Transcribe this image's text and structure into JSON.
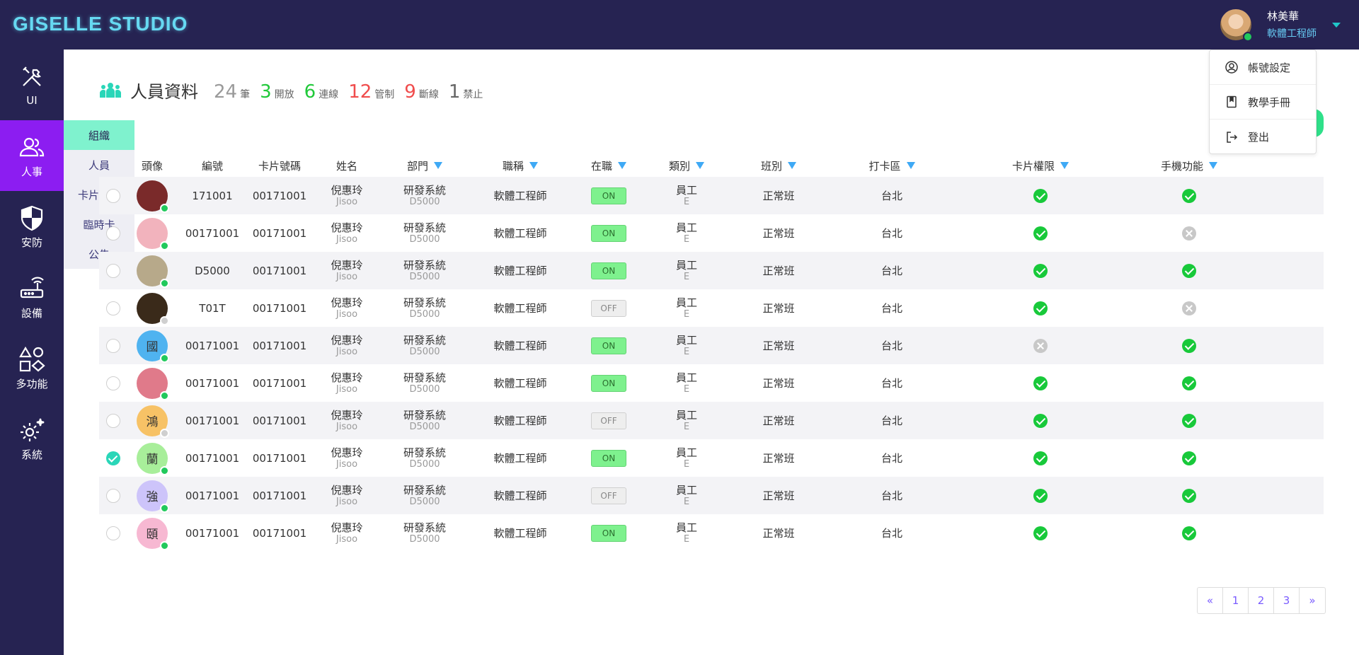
{
  "app": {
    "logo": "GISELLE STUDIO"
  },
  "user": {
    "name": "林美華",
    "role": "軟體工程師"
  },
  "user_menu": [
    {
      "label": "帳號設定",
      "icon": "account-circle-icon"
    },
    {
      "label": "教學手冊",
      "icon": "book-icon"
    },
    {
      "label": "登出",
      "icon": "logout-icon"
    }
  ],
  "sidebar": [
    {
      "label": "UI",
      "icon": "tools-icon",
      "active": false
    },
    {
      "label": "人事",
      "icon": "people-icon",
      "active": true
    },
    {
      "label": "安防",
      "icon": "shield-icon",
      "active": false
    },
    {
      "label": "設備",
      "icon": "router-icon",
      "active": false
    },
    {
      "label": "多功能",
      "icon": "shapes-icon",
      "active": false
    },
    {
      "label": "系統",
      "icon": "gear-icon",
      "active": false
    }
  ],
  "submenu": [
    "組織",
    "人員",
    "卡片權限",
    "臨時卡",
    "公告"
  ],
  "header": {
    "title": "人員資料",
    "stats": [
      {
        "num": "24",
        "label": "筆",
        "color": "gray"
      },
      {
        "num": "3",
        "label": "開放",
        "color": "green"
      },
      {
        "num": "6",
        "label": "連線",
        "color": "green"
      },
      {
        "num": "12",
        "label": "管制",
        "color": "red"
      },
      {
        "num": "9",
        "label": "斷線",
        "color": "red"
      },
      {
        "num": "1",
        "label": "禁止",
        "color": "dark"
      }
    ]
  },
  "table": {
    "columns": [
      "頭像",
      "編號",
      "卡片號碼",
      "姓名",
      "部門",
      "職稱",
      "在職",
      "類別",
      "班別",
      "打卡區",
      "卡片權限",
      "手機功能"
    ],
    "rows": [
      {
        "avatar": "",
        "avatar_bg": "#7a2a2a",
        "online": true,
        "id": "171001",
        "card": "00171001",
        "name": "倪惠玲",
        "name_en": "Jisoo",
        "dept": "研發系統",
        "dept_code": "D5000",
        "title": "軟體工程師",
        "active": "ON",
        "cat": "員工",
        "cat_code": "E",
        "shift": "正常班",
        "area": "台北",
        "perm": true,
        "phone": true,
        "selected": false
      },
      {
        "avatar": "",
        "avatar_bg": "#f2b3bd",
        "online": true,
        "id": "00171001",
        "card": "00171001",
        "name": "倪惠玲",
        "name_en": "Jisoo",
        "dept": "研發系統",
        "dept_code": "D5000",
        "title": "軟體工程師",
        "active": "ON",
        "cat": "員工",
        "cat_code": "E",
        "shift": "正常班",
        "area": "台北",
        "perm": true,
        "phone": false,
        "selected": false
      },
      {
        "avatar": "",
        "avatar_bg": "#b7a98a",
        "online": true,
        "id": "D5000",
        "card": "00171001",
        "name": "倪惠玲",
        "name_en": "Jisoo",
        "dept": "研發系統",
        "dept_code": "D5000",
        "title": "軟體工程師",
        "active": "ON",
        "cat": "員工",
        "cat_code": "E",
        "shift": "正常班",
        "area": "台北",
        "perm": true,
        "phone": true,
        "selected": false
      },
      {
        "avatar": "",
        "avatar_bg": "#3a2a1a",
        "online": false,
        "id": "T01T",
        "card": "00171001",
        "name": "倪惠玲",
        "name_en": "Jisoo",
        "dept": "研發系統",
        "dept_code": "D5000",
        "title": "軟體工程師",
        "active": "OFF",
        "cat": "員工",
        "cat_code": "E",
        "shift": "正常班",
        "area": "台北",
        "perm": true,
        "phone": false,
        "selected": false
      },
      {
        "avatar": "國",
        "avatar_bg": "#4fb3f0",
        "online": true,
        "id": "00171001",
        "card": "00171001",
        "name": "倪惠玲",
        "name_en": "Jisoo",
        "dept": "研發系統",
        "dept_code": "D5000",
        "title": "軟體工程師",
        "active": "ON",
        "cat": "員工",
        "cat_code": "E",
        "shift": "正常班",
        "area": "台北",
        "perm": false,
        "phone": true,
        "selected": false
      },
      {
        "avatar": "",
        "avatar_bg": "#e07a8a",
        "online": true,
        "id": "00171001",
        "card": "00171001",
        "name": "倪惠玲",
        "name_en": "Jisoo",
        "dept": "研發系統",
        "dept_code": "D5000",
        "title": "軟體工程師",
        "active": "ON",
        "cat": "員工",
        "cat_code": "E",
        "shift": "正常班",
        "area": "台北",
        "perm": true,
        "phone": true,
        "selected": false
      },
      {
        "avatar": "鴻",
        "avatar_bg": "#f7c266",
        "online": false,
        "id": "00171001",
        "card": "00171001",
        "name": "倪惠玲",
        "name_en": "Jisoo",
        "dept": "研發系統",
        "dept_code": "D5000",
        "title": "軟體工程師",
        "active": "OFF",
        "cat": "員工",
        "cat_code": "E",
        "shift": "正常班",
        "area": "台北",
        "perm": true,
        "phone": true,
        "selected": false
      },
      {
        "avatar": "蘭",
        "avatar_bg": "#a8ee9a",
        "online": true,
        "id": "00171001",
        "card": "00171001",
        "name": "倪惠玲",
        "name_en": "Jisoo",
        "dept": "研發系統",
        "dept_code": "D5000",
        "title": "軟體工程師",
        "active": "ON",
        "cat": "員工",
        "cat_code": "E",
        "shift": "正常班",
        "area": "台北",
        "perm": true,
        "phone": true,
        "selected": true
      },
      {
        "avatar": "強",
        "avatar_bg": "#cdc4fa",
        "online": true,
        "id": "00171001",
        "card": "00171001",
        "name": "倪惠玲",
        "name_en": "Jisoo",
        "dept": "研發系統",
        "dept_code": "D5000",
        "title": "軟體工程師",
        "active": "OFF",
        "cat": "員工",
        "cat_code": "E",
        "shift": "正常班",
        "area": "台北",
        "perm": true,
        "phone": true,
        "selected": false
      },
      {
        "avatar": "頤",
        "avatar_bg": "#f7b8d2",
        "online": true,
        "id": "00171001",
        "card": "00171001",
        "name": "倪惠玲",
        "name_en": "Jisoo",
        "dept": "研發系統",
        "dept_code": "D5000",
        "title": "軟體工程師",
        "active": "ON",
        "cat": "員工",
        "cat_code": "E",
        "shift": "正常班",
        "area": "台北",
        "perm": true,
        "phone": true,
        "selected": false
      }
    ]
  },
  "pagination": [
    "«",
    "1",
    "2",
    "3",
    "»"
  ],
  "colors": {
    "topbar": "#262352",
    "sidebar_active": "#8c1df1",
    "accent": "#7ff2ce",
    "online": "#21c95c",
    "ok": "#18c93a"
  }
}
